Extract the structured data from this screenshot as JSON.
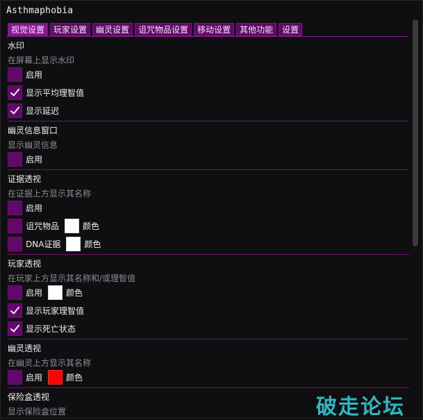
{
  "window": {
    "title": "Asthmaphobia"
  },
  "tabs": [
    {
      "label": "视觉设置"
    },
    {
      "label": "玩家设置"
    },
    {
      "label": "幽灵设置"
    },
    {
      "label": "诅咒物品设置"
    },
    {
      "label": "移动设置"
    },
    {
      "label": "其他功能"
    },
    {
      "label": "设置"
    }
  ],
  "sections": {
    "watermark": {
      "title": "水印",
      "desc": "在屏幕上显示水印",
      "enable": {
        "label": "启用",
        "checked": false
      },
      "avg_sanity": {
        "label": "显示平均理智值",
        "checked": true
      },
      "latency": {
        "label": "显示延迟",
        "checked": true
      }
    },
    "ghost_info": {
      "title": "幽灵信息窗口",
      "desc": "显示幽灵信息",
      "enable": {
        "label": "启用",
        "checked": false
      }
    },
    "evidence": {
      "title": "证据透视",
      "desc": "在证据上方显示其名称",
      "enable": {
        "label": "启用",
        "checked": false
      },
      "cursed": {
        "label": "诅咒物品",
        "color_label": "颜色",
        "color": "#ffffff"
      },
      "dna": {
        "label": "DNA证据",
        "color_label": "颜色",
        "color": "#ffffff"
      }
    },
    "player": {
      "title": "玩家透视",
      "desc": "在玩家上方显示其名称和/或理智值",
      "enable": {
        "label": "启用",
        "color_label": "颜色",
        "color": "#ffffff"
      },
      "sanity": {
        "label": "显示玩家理智值",
        "checked": true
      },
      "dead": {
        "label": "显示死亡状态",
        "checked": true
      }
    },
    "ghost": {
      "title": "幽灵透视",
      "desc": "在幽灵上方显示其名称",
      "enable": {
        "label": "启用",
        "color_label": "颜色",
        "color": "#ff0000"
      }
    },
    "safe": {
      "title": "保险盒透视",
      "desc": "显示保险盒位置"
    }
  },
  "overlay": {
    "text": "破走论坛",
    "color": "#2fb8c2"
  },
  "theme": {
    "accent": "#62086a",
    "active_tab": "#8b1593"
  }
}
